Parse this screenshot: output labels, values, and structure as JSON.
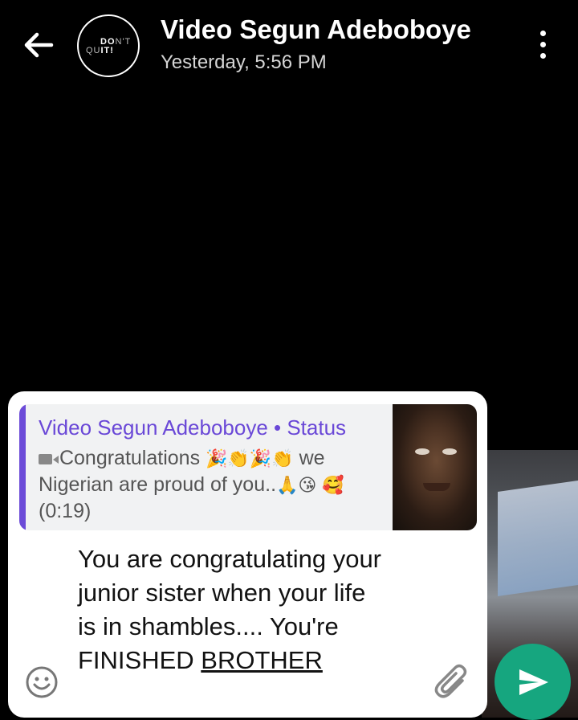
{
  "header": {
    "contact_name": "Video Segun Adeboboye",
    "last_seen": "Yesterday, 5:56 PM",
    "avatar_text_line1": "DON'T",
    "avatar_text_line2": "QUIT!",
    "back_icon": "arrow-left-icon",
    "menu_icon": "more-vertical-icon"
  },
  "reply": {
    "title": "Video Segun Adeboboye • Status",
    "text_before_emoji": "Congratulations",
    "emoji_1": "🎉👏🎉👏",
    "text_mid": "we Nigerian are proud of you..",
    "emoji_2": "🙏😘",
    "emoji_3": "🥰",
    "duration": "(0:19)",
    "media_icon": "video-camera-icon",
    "accent_color": "#6c4bd8"
  },
  "message": {
    "text": "You are congratulating your junior sister when your life is in shambles.... You're FINISHED ",
    "underlined": "BROTHER"
  },
  "composer": {
    "emoji_icon": "emoji-smile-icon",
    "attach_icon": "paperclip-icon",
    "send_icon": "send-icon",
    "send_color": "#16a67f"
  }
}
